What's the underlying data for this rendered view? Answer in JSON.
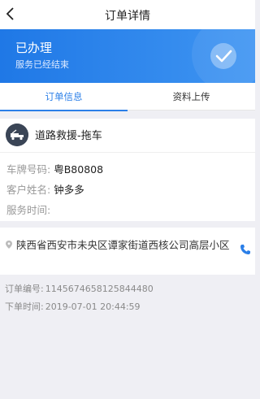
{
  "nav": {
    "title": "订单详情"
  },
  "banner": {
    "status": "已办理",
    "subtitle": "服务已经结束"
  },
  "tabs": [
    {
      "label": "订单信息"
    },
    {
      "label": "资料上传"
    }
  ],
  "service": {
    "name": "道路救援-拖车",
    "icon": "tow-truck-icon"
  },
  "fields": {
    "plate_label": "车牌号码:",
    "plate_value": "粤B80808",
    "customer_label": "客户姓名:",
    "customer_value": "钟多多",
    "time_label": "服务时间:",
    "time_value": ""
  },
  "address": {
    "text": "陕西省西安市未央区谭家街道西核公司高层小区"
  },
  "order": {
    "number_label": "订单编号:",
    "number_value": "1145674658125844480",
    "time_label": "下单时间:",
    "time_value": "2019-07-01 20:44:59"
  },
  "colors": {
    "accent": "#2b7fe8",
    "banner_start": "#1f78e6",
    "banner_end": "#3f95f2"
  }
}
